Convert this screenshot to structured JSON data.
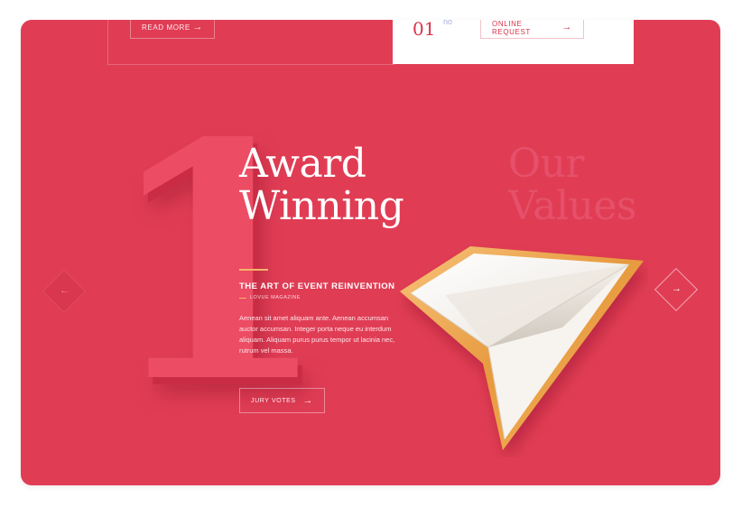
{
  "top": {
    "read_more_label": "READ MORE",
    "card_number": "01",
    "card_superscript": "no",
    "online_request_label": "ONLINE REQUEST",
    "arrow": "→"
  },
  "hero": {
    "big_number": "1",
    "headline_line1": "Award",
    "headline_line2": "Winning",
    "ghost_line1": "Our",
    "ghost_line2": "Values",
    "section_title": "THE ART OF EVENT REINVENTION",
    "magazine": "LOVUE MAGAZINE",
    "body": "Aenean sit amet aliquam ante. Aenean accumsan auctor accumsan. Integer porta neque eu interdum aliquam. Aliquam purus purus tempor ut lacinia nec, rutrum vel massa.",
    "jury_votes_label": "JURY VOTES",
    "arrow": "→"
  },
  "nav": {
    "prev_arrow": "←",
    "next_arrow": "→"
  },
  "icons": {
    "paper_plane": "paper-plane-icon",
    "prev": "arrow-left-icon",
    "next": "arrow-right-icon"
  },
  "colors": {
    "background": "#e03d55",
    "accent_gold": "#f5b46a",
    "number_face": "#ec4c64"
  }
}
